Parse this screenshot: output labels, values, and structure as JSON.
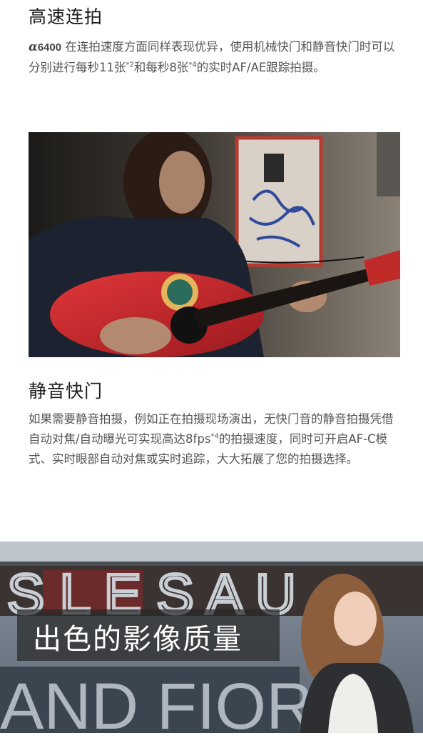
{
  "sections": [
    {
      "title": "高速连拍",
      "model_symbol": "α",
      "model_number": "6400",
      "text_a": " 在连拍速度方面同样表现优异，使用机械快门和静音快门时可以分别进行每秒11张",
      "note_a": "*2",
      "text_b": "和每秒8张",
      "note_b": "*4",
      "text_c": "的实时AF/AE跟踪拍摄。"
    },
    {
      "title": "静音快门",
      "text_a": "如果需要静音拍摄，例如正在拍摄现场演出，无快门音的静音拍摄凭借自动对焦/自动曝光可实现高达8fps",
      "note_a": "*4",
      "text_b": "的拍摄速度，同时可开启AF-C模式、实时眼部自动对焦或实时追踪，大大拓展了您的拍摄选择。"
    }
  ],
  "banner": {
    "title": "出色的影像质量",
    "poster_text": "AND FIOR"
  },
  "colors": {
    "guitar": "#c8242a",
    "banner_bg": "#6f7a86",
    "caption_bg": "#282828"
  }
}
